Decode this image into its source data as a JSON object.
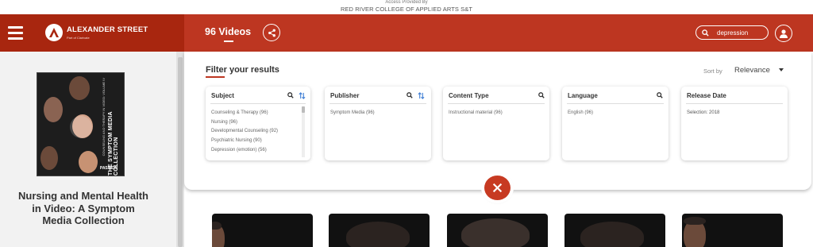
{
  "access": {
    "provided_by": "Access Provided By",
    "institution": "RED RIVER COLLEGE OF APPLIED ARTS S&T"
  },
  "header": {
    "brand": "ALEXANDER STREET",
    "brand_sub": "Part of Clarivate",
    "videos_count": "96 Videos",
    "search_value": "depression"
  },
  "sidebar": {
    "cover_title": "THE SYMPTOM MEDIA COLLECTION",
    "cover_subtitle": "COUNSELING AND THERAPY IN VIDEO: VOLUME IV",
    "cover_badge": "PASSION",
    "collection_title": "Nursing and Mental Health in Video: A Symptom Media Collection"
  },
  "filter": {
    "title": "Filter your results",
    "sort_label": "Sort by",
    "sort_value": "Relevance",
    "facets": [
      {
        "name": "Subject",
        "items": [
          "Counseling & Therapy (96)",
          "Nursing (96)",
          "Developmental Counseling (92)",
          "Psychiatric Nursing (90)",
          "Depression (emotion) (56)"
        ]
      },
      {
        "name": "Publisher",
        "items": [
          "Symptom Media (96)"
        ]
      },
      {
        "name": "Content Type",
        "items": [
          "Instructional material (96)"
        ]
      },
      {
        "name": "Language",
        "items": [
          "English (96)"
        ]
      },
      {
        "name": "Release Date",
        "items": [
          "Selection: 2018"
        ]
      }
    ]
  },
  "colors": {
    "header_red": "#bd3621",
    "header_dark_red": "#a8260f",
    "close_red": "#c73a22"
  },
  "icons": [
    "hamburger-icon",
    "alexander-street-logo",
    "share-icon",
    "search-icon",
    "user-icon",
    "sort-icon",
    "close-icon",
    "caret-down-icon"
  ]
}
